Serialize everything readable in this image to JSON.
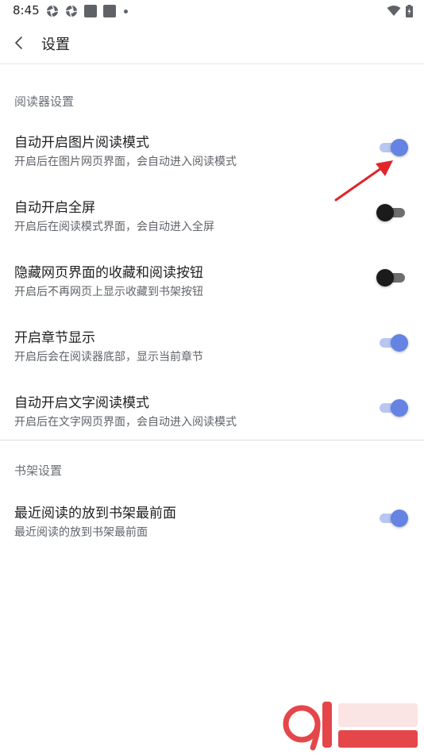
{
  "status_bar": {
    "time": "8:45"
  },
  "app_bar": {
    "title": "设置"
  },
  "sections": [
    {
      "header": "阅读器设置",
      "rows": [
        {
          "title": "自动开启图片阅读模式",
          "subtitle": "开启后在图片网页界面，会自动进入阅读模式",
          "enabled": true
        },
        {
          "title": "自动开启全屏",
          "subtitle": "开启后在阅读模式界面，会自动进入全屏",
          "enabled": false
        },
        {
          "title": "隐藏网页界面的收藏和阅读按钮",
          "subtitle": "开启后不再网页上显示收藏到书架按钮",
          "enabled": false
        },
        {
          "title": "开启章节显示",
          "subtitle": "开启后会在阅读器底部，显示当前章节",
          "enabled": true
        },
        {
          "title": "自动开启文字阅读模式",
          "subtitle": "开启后在文字网页界面，会自动进入阅读模式",
          "enabled": true
        }
      ]
    },
    {
      "header": "书架设置",
      "rows": [
        {
          "title": "最近阅读的放到书架最前面",
          "subtitle": "最近阅读的放到书架最前面",
          "enabled": true
        }
      ]
    }
  ],
  "colors": {
    "switch_on_thumb": "#6483e2",
    "switch_on_track": "#b8c6f2",
    "switch_off_thumb": "#1b1b1b",
    "switch_off_track": "#6e6e6e",
    "annotation": "#e0262b"
  },
  "icons": {
    "back": "chevron-left-icon",
    "status_left": [
      "aperture-icon",
      "aperture-icon",
      "app-square-icon",
      "app-square-icon",
      "notification-dot-icon"
    ],
    "status_right": [
      "wifi-icon",
      "battery-icon"
    ]
  }
}
